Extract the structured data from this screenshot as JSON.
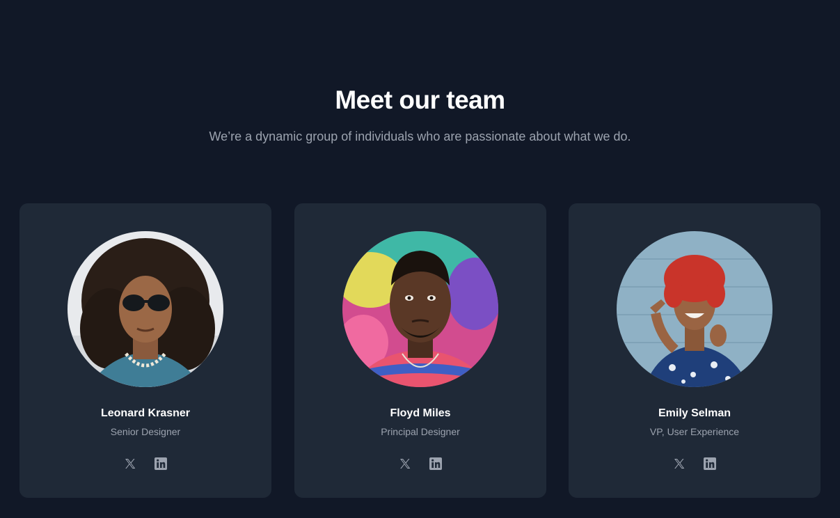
{
  "section": {
    "title": "Meet our team",
    "subtitle": "We’re a dynamic group of individuals who are passionate about what we do."
  },
  "team": [
    {
      "name": "Leonard Krasner",
      "role": "Senior Designer",
      "avatar_bg": "#e7e9ec",
      "socials": [
        "x-icon",
        "linkedin-icon"
      ]
    },
    {
      "name": "Floyd Miles",
      "role": "Principal Designer",
      "avatar_bg": "#d9468a",
      "socials": [
        "x-icon",
        "linkedin-icon"
      ]
    },
    {
      "name": "Emily Selman",
      "role": "VP, User Experience",
      "avatar_bg": "#8fb0c4",
      "socials": [
        "x-icon",
        "linkedin-icon"
      ]
    }
  ],
  "colors": {
    "page_bg": "#111827",
    "card_bg": "#1f2937",
    "heading": "#ffffff",
    "muted": "#9ca3af",
    "icon": "#9ca3af"
  }
}
